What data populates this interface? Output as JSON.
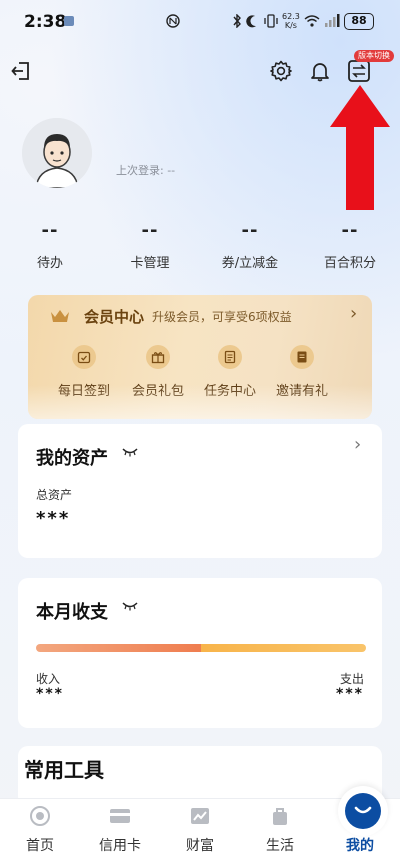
{
  "status_bar": {
    "time": "2:38",
    "net_speed_value": "62.3",
    "net_speed_unit": "K/s",
    "battery": "88"
  },
  "header": {
    "version_switch_badge": "版本切换"
  },
  "profile": {
    "last_login": "上次登录: --"
  },
  "stats": [
    {
      "value": "--",
      "label": "待办"
    },
    {
      "value": "--",
      "label": "卡管理"
    },
    {
      "value": "--",
      "label": "券/立减金"
    },
    {
      "value": "--",
      "label": "百合积分"
    }
  ],
  "vip": {
    "title": "会员中心",
    "subtitle": "升级会员，可享受6项权益",
    "items": [
      {
        "label": "每日签到",
        "icon": "calendar-check-icon"
      },
      {
        "label": "会员礼包",
        "icon": "gift-icon"
      },
      {
        "label": "任务中心",
        "icon": "task-list-icon"
      },
      {
        "label": "邀请有礼",
        "icon": "invite-doc-icon"
      }
    ]
  },
  "assets": {
    "title": "我的资产",
    "total_label": "总资产",
    "total_value": "***"
  },
  "monthly": {
    "title": "本月收支",
    "income_label": "收入",
    "income_value": "***",
    "expense_label": "支出",
    "expense_value": "***"
  },
  "tools": {
    "title": "常用工具"
  },
  "bottom_nav": [
    {
      "label": "首页",
      "icon": "home-icon",
      "active": false
    },
    {
      "label": "信用卡",
      "icon": "credit-card-icon",
      "active": false
    },
    {
      "label": "财富",
      "icon": "wealth-chart-icon",
      "active": false
    },
    {
      "label": "生活",
      "icon": "life-bag-icon",
      "active": false
    },
    {
      "label": "我的",
      "icon": "profile-icon",
      "active": true
    }
  ],
  "colors": {
    "accent": "#0c4da2",
    "annotation_arrow": "#e8101a",
    "vip_gold": "#f3d8ab"
  }
}
